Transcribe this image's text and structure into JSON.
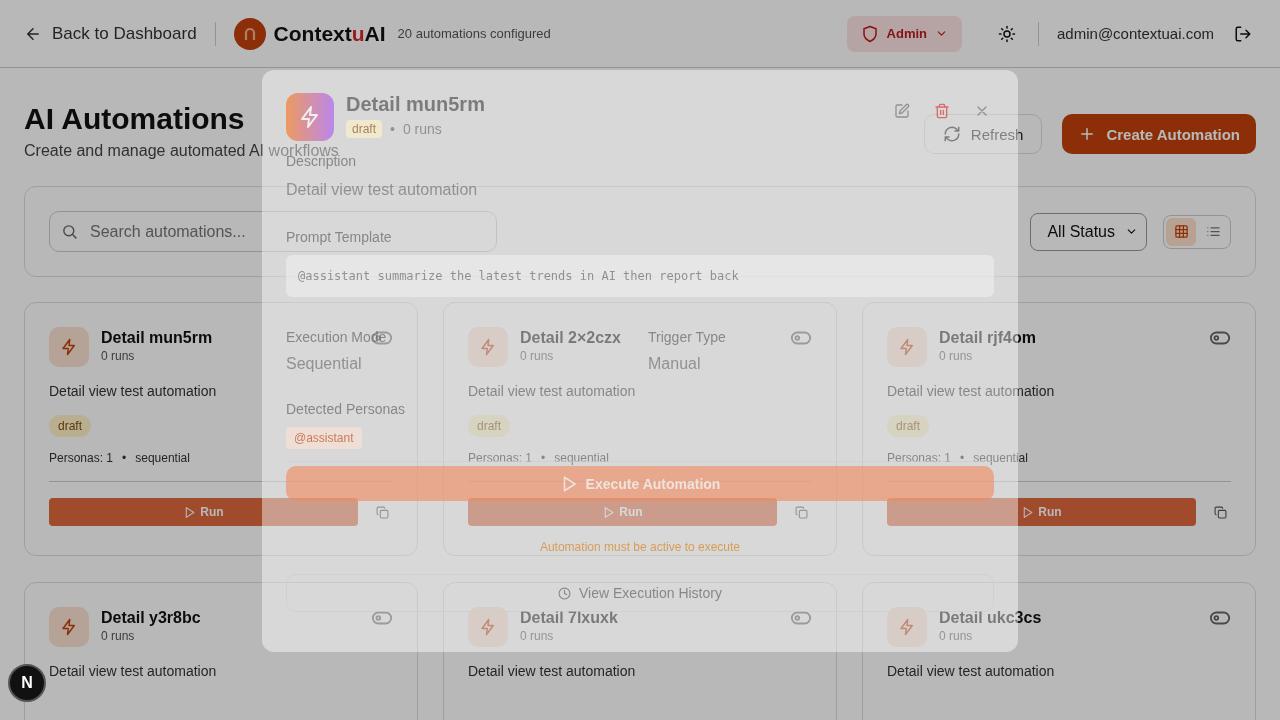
{
  "header": {
    "back": "Back to Dashboard",
    "brand": {
      "before": "Context",
      "accent": "u",
      "after": "AI"
    },
    "count": "20 automations configured",
    "role": "Admin",
    "email": "admin@contextuai.com"
  },
  "page": {
    "title": "AI Automations",
    "subtitle": "Create and manage automated AI workflows",
    "refresh": "Refresh",
    "create": "Create Automation"
  },
  "filters": {
    "search": {
      "placeholder": "Search automations..."
    },
    "status": "All Status",
    "views": [
      {
        "kind": "grid",
        "selected": true
      },
      {
        "kind": "list",
        "selected": false
      }
    ]
  },
  "cards": [
    {
      "name": "Detail mun5rm",
      "runs": "0 runs",
      "description": "Detail view test automation",
      "status": "draft",
      "personas": "Personas: 1",
      "mode": "sequential",
      "run": "Run",
      "active": false
    },
    {
      "name": "Detail 2×2czx",
      "runs": "0 runs",
      "description": "Detail view test automation",
      "status": "draft",
      "personas": "Personas: 1",
      "mode": "sequential",
      "run": "Run",
      "active": false
    },
    {
      "name": "Detail rjf4om",
      "runs": "0 runs",
      "description": "Detail view test automation",
      "status": "draft",
      "personas": "Personas: 1",
      "mode": "sequential",
      "run": "Run",
      "active": false
    },
    {
      "name": "Detail y3r8bc",
      "runs": "0 runs",
      "description": "Detail view test automation",
      "active": false
    },
    {
      "name": "Detail 7lxuxk",
      "runs": "0 runs",
      "description": "Detail view test automation",
      "active": false
    },
    {
      "name": "Detail ukc3cs",
      "runs": "0 runs",
      "description": "Detail view test automation",
      "active": false
    }
  ],
  "modal": {
    "title": "Detail mun5rm",
    "status": "draft",
    "runs": "0 runs",
    "description_label": "Description",
    "description": "Detail view test automation",
    "prompt_label": "Prompt Template",
    "prompt": "@assistant summarize the latest trends in AI then report back",
    "fields": [
      {
        "label": "Execution Mode",
        "value": "Sequential"
      },
      {
        "label": "Trigger Type",
        "value": "Manual"
      }
    ],
    "personas_label": "Detected Personas",
    "personas": [
      "@assistant"
    ],
    "execute": {
      "label": "Execute Automation",
      "disabled": true
    },
    "note": "Automation must be active to execute",
    "history": "View Execution History"
  },
  "separator": "•",
  "dev_badge": "N"
}
